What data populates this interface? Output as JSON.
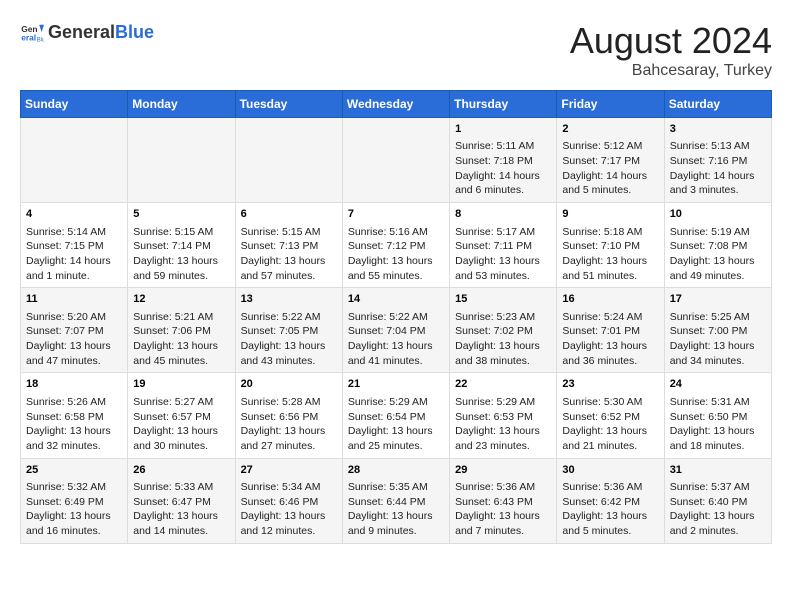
{
  "logo": {
    "general": "General",
    "blue": "Blue"
  },
  "title": "August 2024",
  "subtitle": "Bahcesaray, Turkey",
  "days_header": [
    "Sunday",
    "Monday",
    "Tuesday",
    "Wednesday",
    "Thursday",
    "Friday",
    "Saturday"
  ],
  "weeks": [
    [
      {
        "day": "",
        "content": ""
      },
      {
        "day": "",
        "content": ""
      },
      {
        "day": "",
        "content": ""
      },
      {
        "day": "",
        "content": ""
      },
      {
        "day": "1",
        "content": "Sunrise: 5:11 AM\nSunset: 7:18 PM\nDaylight: 14 hours\nand 6 minutes."
      },
      {
        "day": "2",
        "content": "Sunrise: 5:12 AM\nSunset: 7:17 PM\nDaylight: 14 hours\nand 5 minutes."
      },
      {
        "day": "3",
        "content": "Sunrise: 5:13 AM\nSunset: 7:16 PM\nDaylight: 14 hours\nand 3 minutes."
      }
    ],
    [
      {
        "day": "4",
        "content": "Sunrise: 5:14 AM\nSunset: 7:15 PM\nDaylight: 14 hours\nand 1 minute."
      },
      {
        "day": "5",
        "content": "Sunrise: 5:15 AM\nSunset: 7:14 PM\nDaylight: 13 hours\nand 59 minutes."
      },
      {
        "day": "6",
        "content": "Sunrise: 5:15 AM\nSunset: 7:13 PM\nDaylight: 13 hours\nand 57 minutes."
      },
      {
        "day": "7",
        "content": "Sunrise: 5:16 AM\nSunset: 7:12 PM\nDaylight: 13 hours\nand 55 minutes."
      },
      {
        "day": "8",
        "content": "Sunrise: 5:17 AM\nSunset: 7:11 PM\nDaylight: 13 hours\nand 53 minutes."
      },
      {
        "day": "9",
        "content": "Sunrise: 5:18 AM\nSunset: 7:10 PM\nDaylight: 13 hours\nand 51 minutes."
      },
      {
        "day": "10",
        "content": "Sunrise: 5:19 AM\nSunset: 7:08 PM\nDaylight: 13 hours\nand 49 minutes."
      }
    ],
    [
      {
        "day": "11",
        "content": "Sunrise: 5:20 AM\nSunset: 7:07 PM\nDaylight: 13 hours\nand 47 minutes."
      },
      {
        "day": "12",
        "content": "Sunrise: 5:21 AM\nSunset: 7:06 PM\nDaylight: 13 hours\nand 45 minutes."
      },
      {
        "day": "13",
        "content": "Sunrise: 5:22 AM\nSunset: 7:05 PM\nDaylight: 13 hours\nand 43 minutes."
      },
      {
        "day": "14",
        "content": "Sunrise: 5:22 AM\nSunset: 7:04 PM\nDaylight: 13 hours\nand 41 minutes."
      },
      {
        "day": "15",
        "content": "Sunrise: 5:23 AM\nSunset: 7:02 PM\nDaylight: 13 hours\nand 38 minutes."
      },
      {
        "day": "16",
        "content": "Sunrise: 5:24 AM\nSunset: 7:01 PM\nDaylight: 13 hours\nand 36 minutes."
      },
      {
        "day": "17",
        "content": "Sunrise: 5:25 AM\nSunset: 7:00 PM\nDaylight: 13 hours\nand 34 minutes."
      }
    ],
    [
      {
        "day": "18",
        "content": "Sunrise: 5:26 AM\nSunset: 6:58 PM\nDaylight: 13 hours\nand 32 minutes."
      },
      {
        "day": "19",
        "content": "Sunrise: 5:27 AM\nSunset: 6:57 PM\nDaylight: 13 hours\nand 30 minutes."
      },
      {
        "day": "20",
        "content": "Sunrise: 5:28 AM\nSunset: 6:56 PM\nDaylight: 13 hours\nand 27 minutes."
      },
      {
        "day": "21",
        "content": "Sunrise: 5:29 AM\nSunset: 6:54 PM\nDaylight: 13 hours\nand 25 minutes."
      },
      {
        "day": "22",
        "content": "Sunrise: 5:29 AM\nSunset: 6:53 PM\nDaylight: 13 hours\nand 23 minutes."
      },
      {
        "day": "23",
        "content": "Sunrise: 5:30 AM\nSunset: 6:52 PM\nDaylight: 13 hours\nand 21 minutes."
      },
      {
        "day": "24",
        "content": "Sunrise: 5:31 AM\nSunset: 6:50 PM\nDaylight: 13 hours\nand 18 minutes."
      }
    ],
    [
      {
        "day": "25",
        "content": "Sunrise: 5:32 AM\nSunset: 6:49 PM\nDaylight: 13 hours\nand 16 minutes."
      },
      {
        "day": "26",
        "content": "Sunrise: 5:33 AM\nSunset: 6:47 PM\nDaylight: 13 hours\nand 14 minutes."
      },
      {
        "day": "27",
        "content": "Sunrise: 5:34 AM\nSunset: 6:46 PM\nDaylight: 13 hours\nand 12 minutes."
      },
      {
        "day": "28",
        "content": "Sunrise: 5:35 AM\nSunset: 6:44 PM\nDaylight: 13 hours\nand 9 minutes."
      },
      {
        "day": "29",
        "content": "Sunrise: 5:36 AM\nSunset: 6:43 PM\nDaylight: 13 hours\nand 7 minutes."
      },
      {
        "day": "30",
        "content": "Sunrise: 5:36 AM\nSunset: 6:42 PM\nDaylight: 13 hours\nand 5 minutes."
      },
      {
        "day": "31",
        "content": "Sunrise: 5:37 AM\nSunset: 6:40 PM\nDaylight: 13 hours\nand 2 minutes."
      }
    ]
  ]
}
